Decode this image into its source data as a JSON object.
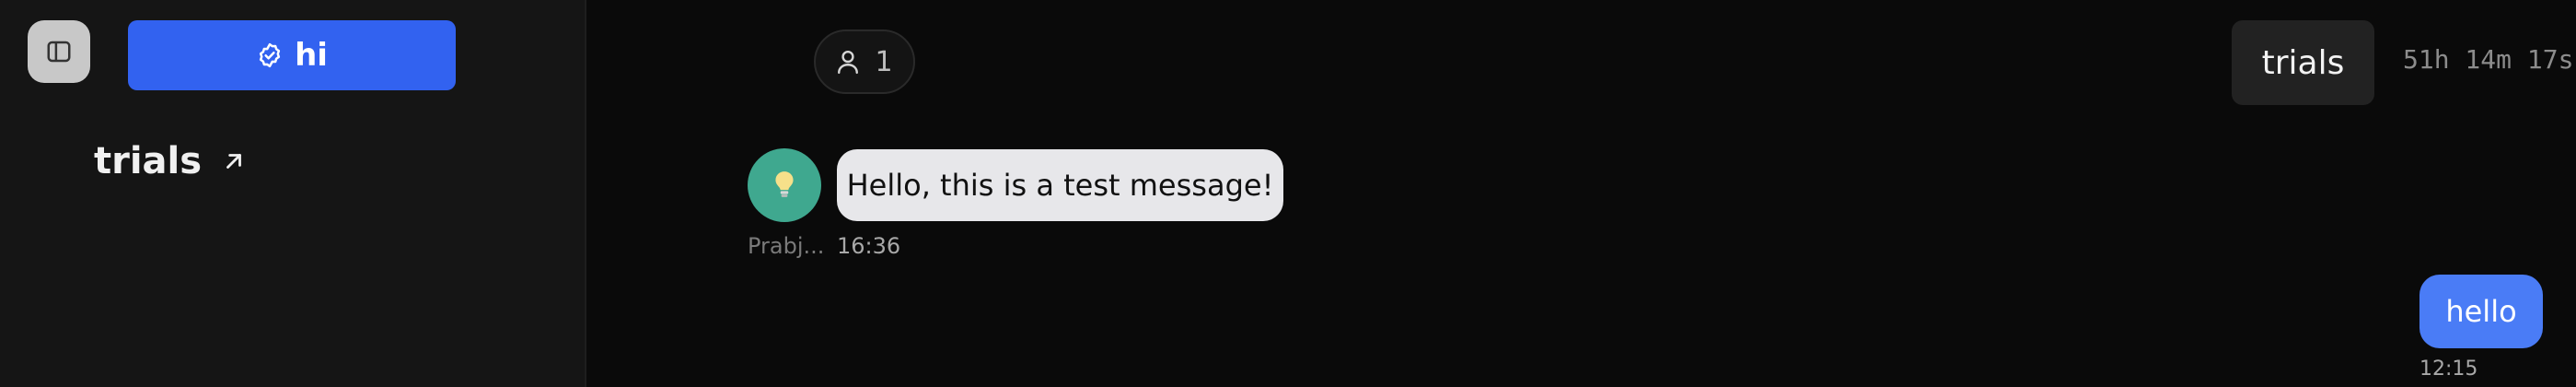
{
  "sidebar": {
    "space_button_label": "hi",
    "items": [
      {
        "label": "trials"
      }
    ]
  },
  "header": {
    "user_count": "1",
    "channel_name": "trials",
    "timer": "51h 14m 17s"
  },
  "messages": [
    {
      "sender": "Prabj...",
      "text": "Hello, this is a test message!",
      "time": "16:36"
    },
    {
      "sender": "",
      "text": "hello",
      "time": "12:15"
    }
  ],
  "colors": {
    "accent": "#3262f0",
    "self_bubble": "#4a7cf6",
    "avatar": "#3fa88f"
  },
  "icons": {
    "sidebar_toggle": "sidebar-panel-icon",
    "space_badge": "check-badge-icon",
    "external_link": "arrow-up-right-icon",
    "users": "person-icon",
    "avatar": "lightbulb-icon"
  }
}
